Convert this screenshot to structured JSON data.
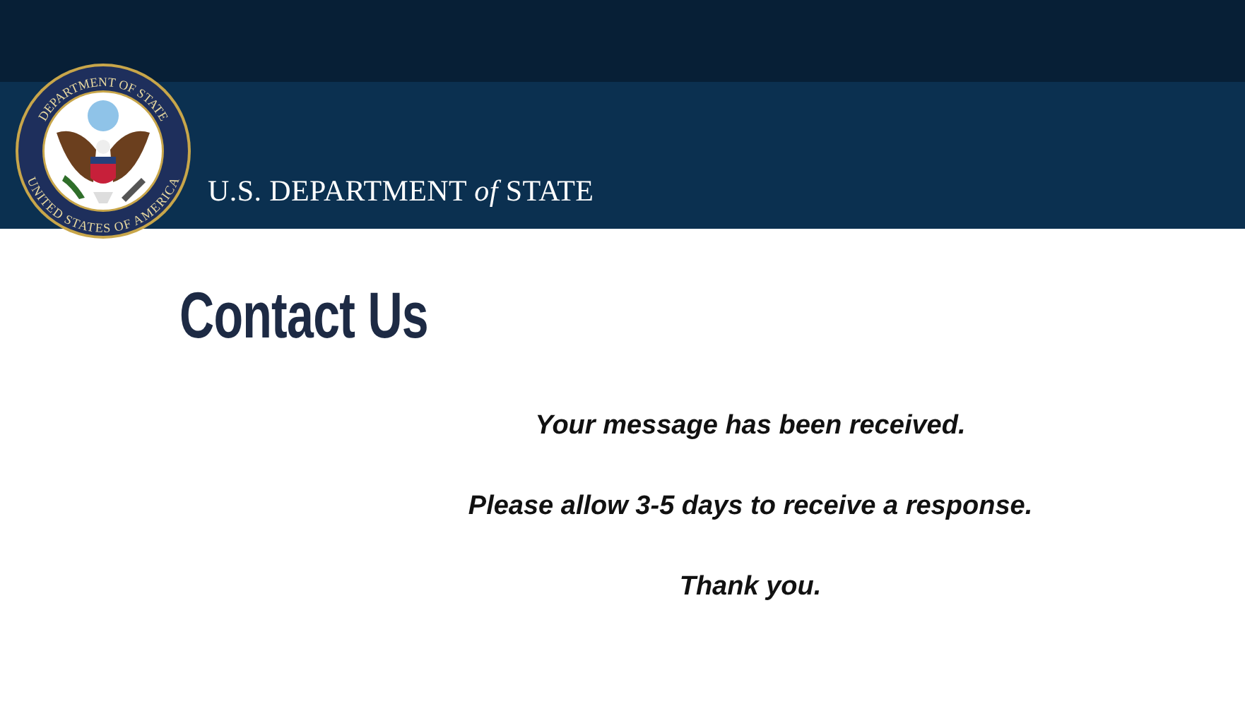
{
  "header": {
    "seal": {
      "top_text": "DEPARTMENT OF STATE",
      "bottom_text": "UNITED STATES OF AMERICA"
    },
    "wordmark": "U.S. DEPARTMENT *of* STATE"
  },
  "title": "Contact Us",
  "messages": [
    "Your message has been received.",
    "Please allow 3-5 days to receive a response.",
    "Thank you."
  ]
}
